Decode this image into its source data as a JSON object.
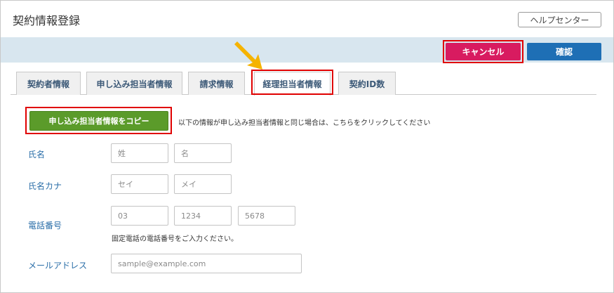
{
  "header": {
    "title": "契約情報登録",
    "help_label": "ヘルプセンター"
  },
  "toolbar": {
    "cancel_label": "キャンセル",
    "confirm_label": "確認",
    "cancel_color": "#d81b60",
    "confirm_color": "#1e6fb5"
  },
  "tabs": [
    {
      "label": "契約者情報",
      "active": false
    },
    {
      "label": "申し込み担当者情報",
      "active": false
    },
    {
      "label": "請求情報",
      "active": false
    },
    {
      "label": "経理担当者情報",
      "active": true
    },
    {
      "label": "契約ID数",
      "active": false
    }
  ],
  "copy": {
    "button_label": "申し込み担当者情報をコピー",
    "note": "以下の情報が申し込み担当者情報と同じ場合は、こちらをクリックしてください"
  },
  "form": {
    "name": {
      "label": "氏名",
      "last_placeholder": "姓",
      "first_placeholder": "名"
    },
    "kana": {
      "label": "氏名カナ",
      "last_placeholder": "セイ",
      "first_placeholder": "メイ"
    },
    "phone": {
      "label": "電話番号",
      "p1_placeholder": "03",
      "p2_placeholder": "1234",
      "p3_placeholder": "5678",
      "hint": "固定電話の電話番号をご入力ください。"
    },
    "email": {
      "label": "メールアドレス",
      "placeholder": "sample@example.com"
    }
  },
  "annotations": {
    "highlight_color": "#e00000",
    "arrow_color": "#f5b300"
  }
}
